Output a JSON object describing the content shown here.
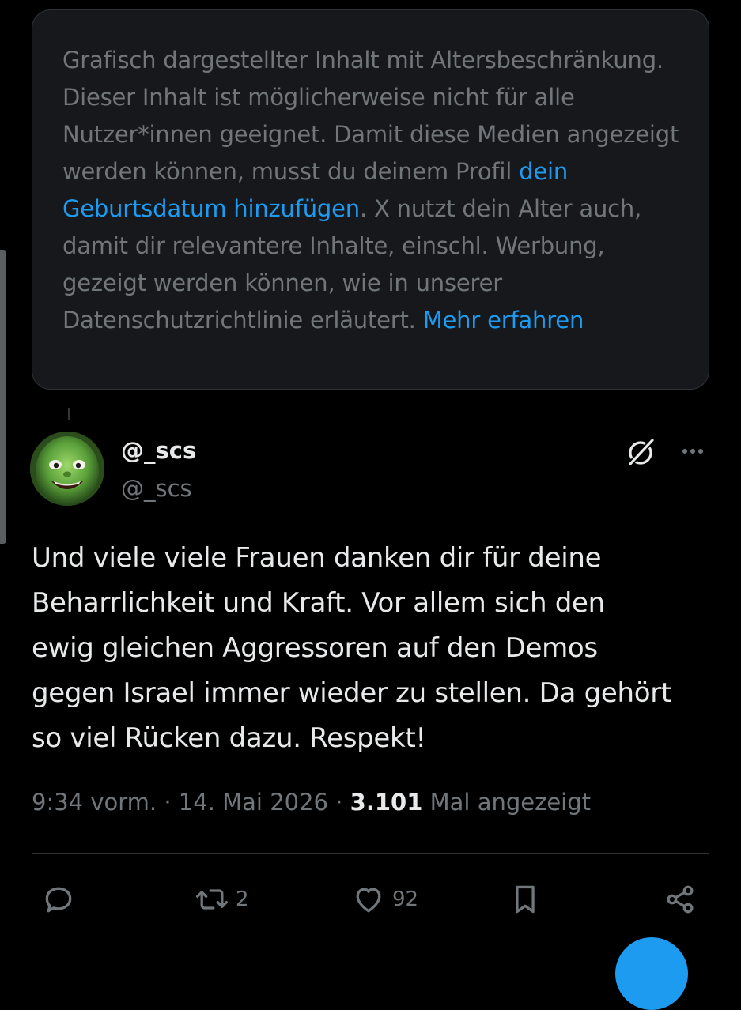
{
  "warning": {
    "text_before": "Grafisch dargestellter Inhalt mit Altersbeschränkung. Dieser Inhalt ist möglicherweise nicht für alle Nutzer*innen geeignet. Damit diese Medien angezeigt werden können, musst du deinem Profil ",
    "link_birthdate": "dein Geburtsdatum hinzufügen",
    "text_after": ". X nutzt dein Alter auch, damit dir relevantere Inhalte, einschl. Werbung, gezeigt werden können, wie in unserer Datenschutzrichtlinie erläutert. ",
    "link_more": "Mehr erfahren"
  },
  "tweet": {
    "display_name": "@_scs",
    "handle": "@_scs",
    "text": "Und viele viele Frauen danken dir für deine\nBeharrlichkeit und Kraft. Vor allem sich den\newig gleichen Aggressoren auf den Demos\ngegen Israel immer wieder zu stellen. Da gehört\nso viel Rücken dazu. Respekt!",
    "time": "9:34 vorm.",
    "separator": " · ",
    "date": "14. Mai 2026",
    "views_count": "3.101",
    "views_label": " Mal angezeigt"
  },
  "actions": {
    "reply_icon": "speech-bubble-icon",
    "repost_icon": "repost-icon",
    "repost_count": "2",
    "like_icon": "heart-icon",
    "like_count": "92",
    "bookmark_icon": "bookmark-icon",
    "share_icon": "share-icon"
  },
  "colors": {
    "background": "#000000",
    "card": "#16181c",
    "muted_text": "#71767b",
    "primary_text": "#e7e9ea",
    "link": "#1d9bf0"
  }
}
